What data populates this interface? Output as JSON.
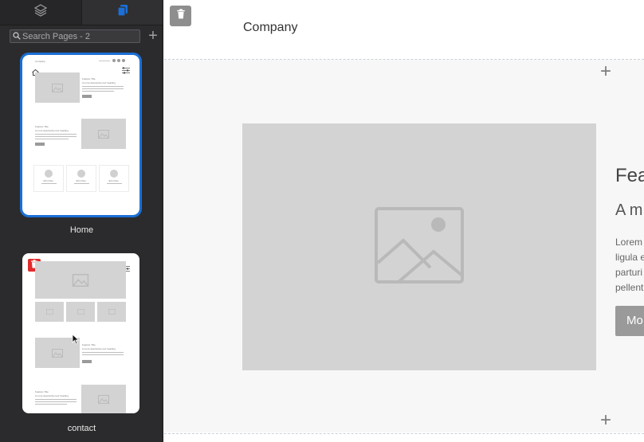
{
  "sidebar": {
    "tabs": [
      {
        "name": "layers",
        "icon": "layers-icon",
        "active": false
      },
      {
        "name": "pages",
        "icon": "pages-icon",
        "active": true
      }
    ],
    "search": {
      "placeholder": "Search Pages - 2",
      "value": ""
    },
    "add_page_label": "+",
    "pages": [
      {
        "label": "Home",
        "selected": true,
        "thumbnail": {
          "logo_text": "Company",
          "feature_title": "Feature Title",
          "feature_subtitle": "A more descriptive text heading",
          "team_names": [
            "John Doe",
            "John Doe",
            "John Doe"
          ]
        }
      },
      {
        "label": "contact",
        "selected": false,
        "thumbnail": {
          "feature_title": "Feature Title",
          "feature_subtitle": "A more descriptive text heading"
        }
      }
    ]
  },
  "canvas": {
    "header": {
      "brand": "Company"
    },
    "content": {
      "title": "Fea",
      "subtitle": "A m",
      "body_lines": [
        "Lorem",
        "ligula e",
        "parturi",
        "pellent"
      ],
      "button_label": "Mo"
    },
    "add_section_label": "+"
  },
  "colors": {
    "sidebar_bg": "#2b2b2d",
    "accent_blue": "#1b6fd6",
    "danger_red": "#e12b2b",
    "placeholder_gray": "#d3d3d3"
  }
}
